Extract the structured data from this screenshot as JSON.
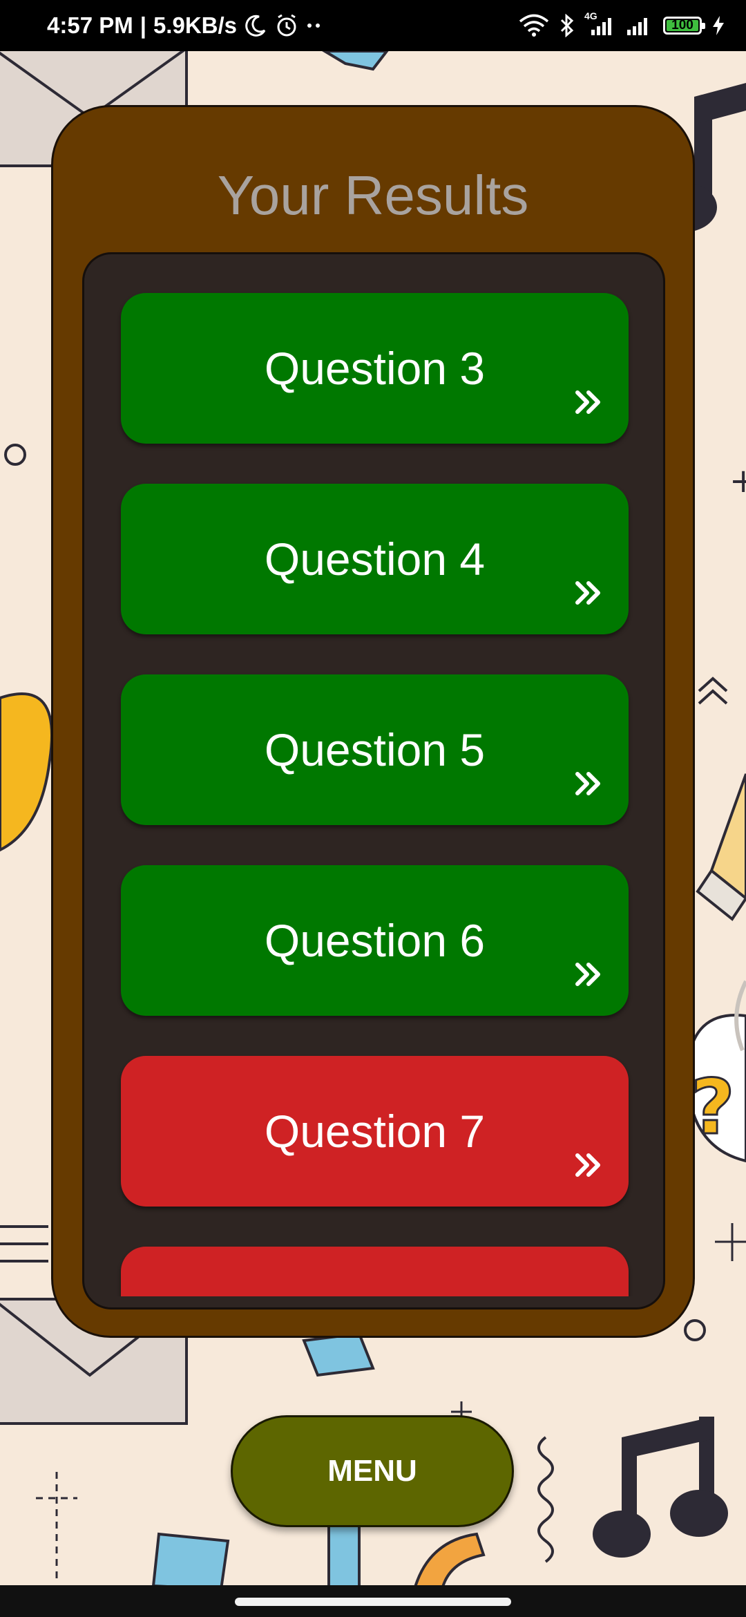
{
  "status_bar": {
    "time": "4:57 PM",
    "separator": "|",
    "speed": "5.9KB/s",
    "network_type": "4G",
    "battery_level": "100",
    "icons": [
      "moon-icon",
      "alarm-icon",
      "more-dots-icon",
      "wifi-icon",
      "bluetooth-icon",
      "signal-icon",
      "signal-icon-2",
      "battery-icon",
      "charging-icon"
    ]
  },
  "results": {
    "title": "Your Results",
    "questions": [
      {
        "label": "Question 3",
        "status": "correct",
        "color": "#007800"
      },
      {
        "label": "Question 4",
        "status": "correct",
        "color": "#007800"
      },
      {
        "label": "Question 5",
        "status": "correct",
        "color": "#007800"
      },
      {
        "label": "Question 6",
        "status": "correct",
        "color": "#007800"
      },
      {
        "label": "Question 7",
        "status": "wrong",
        "color": "#cf2224"
      },
      {
        "label": "",
        "status": "wrong",
        "color": "#cf2224"
      }
    ],
    "arrow_icon": "double-chevron-right-icon"
  },
  "menu": {
    "label": "MENU"
  },
  "colors": {
    "card": "#663a00",
    "panel": "#2e2522",
    "menu_button": "#5d6600",
    "background": "#f7e9da"
  }
}
